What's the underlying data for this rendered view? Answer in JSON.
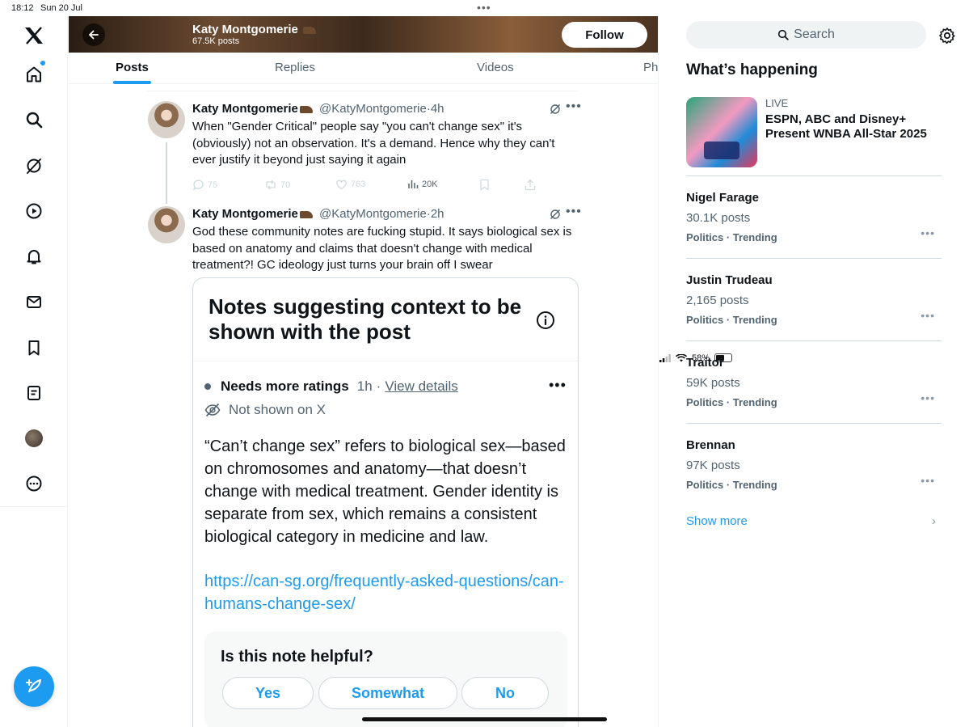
{
  "status_bar": {
    "time": "18:12",
    "date": "Sun 20 Jul",
    "battery": "58%",
    "battery_level": 0.58
  },
  "profile": {
    "name": "Katy Montgomerie",
    "post_count": "67.5K posts",
    "follow_label": "Follow"
  },
  "tabs": [
    {
      "label": "Posts",
      "active": true
    },
    {
      "label": "Replies",
      "active": false
    },
    {
      "label": "Videos",
      "active": false
    },
    {
      "label": "Ph",
      "active": false
    }
  ],
  "tweets": [
    {
      "name": "Katy Montgomerie",
      "handle": "@KatyMontgomerie",
      "sep": "·",
      "time": "4h",
      "text": "When \"Gender Critical\" people say \"you can't change sex\" it's (obviously) not an observation. It's a demand. Hence why they can't ever justify it beyond just saying it again",
      "replies": "75",
      "reposts": "70",
      "likes": "763",
      "views": "20K"
    },
    {
      "name": "Katy Montgomerie",
      "handle": "@KatyMontgomerie",
      "sep": "·",
      "time": "2h",
      "text": "God these community notes are fucking stupid. It says biological sex is based on anatomy and claims that doesn't change with medical treatment?! GC ideology just turns your brain off I swear"
    }
  ],
  "note": {
    "title": "Notes suggesting context to be shown with the post",
    "status": "Needs more ratings",
    "time": "1h",
    "sep": "·",
    "details_link": "View details",
    "hidden_label": "Not shown on X",
    "body": "“Can’t change sex” refers to biological sex—based on chromosomes and anatomy—that doesn’t change with medical treatment. Gender identity is separate from sex, which remains a consistent biological category in medicine and law.",
    "url": "https://can-sg.org/frequently-asked-questions/can-humans-change-sex/",
    "helpful_question": "Is this note helpful?",
    "buttons": {
      "yes": "Yes",
      "somewhat": "Somewhat",
      "no": "No"
    }
  },
  "sidebar": {
    "search_placeholder": "Search",
    "whats_happening": "What’s happening",
    "live": {
      "tag": "LIVE",
      "title": "ESPN, ABC and Disney+ Present WNBA All-Star 2025"
    },
    "trends": [
      {
        "name": "Nigel Farage",
        "count": "30.1K posts",
        "meta": "Politics · Trending"
      },
      {
        "name": "Justin Trudeau",
        "count": "2,165 posts",
        "meta": "Politics · Trending"
      },
      {
        "name": "Traitor",
        "count": "59K posts",
        "meta": "Politics · Trending"
      },
      {
        "name": "Brennan",
        "count": "97K posts",
        "meta": "Politics · Trending"
      }
    ],
    "show_more": "Show more"
  },
  "colors": {
    "accent": "#1d9bf0",
    "text": "#0f1419",
    "muted": "#536471",
    "border": "#cfd9de"
  },
  "icons": {
    "nav": [
      "x-logo-icon",
      "home-icon",
      "search-icon",
      "grok-icon",
      "video-icon",
      "bell-icon",
      "mail-icon",
      "bookmark-icon",
      "list-icon",
      "profile-avatar",
      "more-circle-icon"
    ],
    "compose": "compose-feather-icon"
  }
}
